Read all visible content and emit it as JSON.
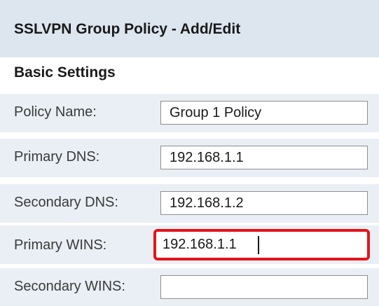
{
  "header": {
    "title": "SSLVPN Group Policy - Add/Edit"
  },
  "basic_settings": {
    "title": "Basic Settings",
    "fields": [
      {
        "label": "Policy Name:",
        "value": "Group 1 Policy",
        "placeholder": ""
      },
      {
        "label": "Primary DNS:",
        "value": "192.168.1.1",
        "placeholder": ""
      },
      {
        "label": "Secondary DNS:",
        "value": "192.168.1.2",
        "placeholder": ""
      },
      {
        "label": "Primary WINS:",
        "value": "192.168.1.1",
        "placeholder": "",
        "focused": true
      },
      {
        "label": "Secondary WINS:",
        "value": "",
        "placeholder": ""
      }
    ]
  },
  "colors": {
    "header_background": "#dde6ef",
    "row_background": "#e9eff5",
    "focus_highlight": "#e4141b",
    "input_border": "#8e8e8e"
  }
}
